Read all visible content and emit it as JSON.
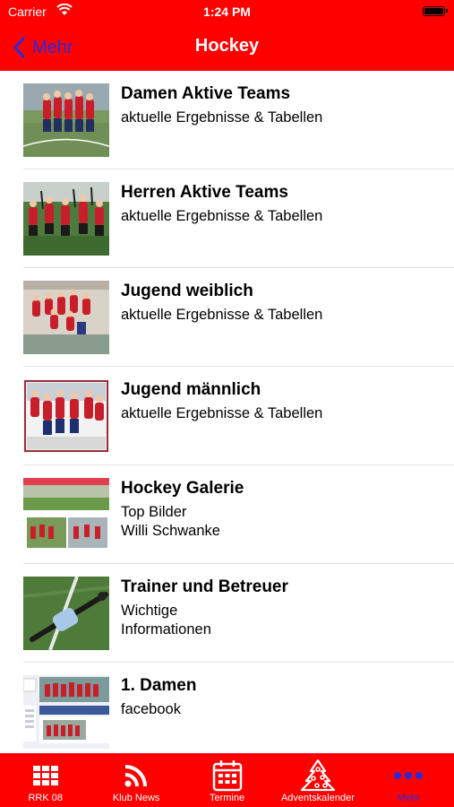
{
  "status": {
    "carrier": "Carrier",
    "time": "1:24 PM"
  },
  "nav": {
    "back_label": "Mehr",
    "title": "Hockey"
  },
  "items": [
    {
      "title": "Damen Aktive Teams",
      "subtitle": "aktuelle Ergebnisse & Tabellen",
      "thumb": "team-photo"
    },
    {
      "title": "Herren Aktive Teams",
      "subtitle": "aktuelle Ergebnisse & Tabellen",
      "thumb": "team-photo"
    },
    {
      "title": "Jugend weiblich",
      "subtitle": "aktuelle Ergebnisse & Tabellen",
      "thumb": "team-photo"
    },
    {
      "title": "Jugend männlich",
      "subtitle": "aktuelle Ergebnisse & Tabellen",
      "thumb": "team-photo"
    },
    {
      "title": "Hockey Galerie",
      "subtitle": "Top Bilder\nWilli Schwanke",
      "thumb": "gallery-photo"
    },
    {
      "title": "Trainer und Betreuer",
      "subtitle": "Wichtige\nInformationen",
      "thumb": "hockey-stick-photo"
    },
    {
      "title": "1. Damen",
      "subtitle": "facebook",
      "thumb": "facebook-page-photo"
    }
  ],
  "tabs": [
    {
      "label": "RRK 08",
      "icon": "grid-icon",
      "active": false
    },
    {
      "label": "Klub News",
      "icon": "rss-icon",
      "active": false
    },
    {
      "label": "Termine",
      "icon": "calendar-icon",
      "active": false
    },
    {
      "label": "Adventskalender",
      "icon": "christmas-tree-icon",
      "active": false
    },
    {
      "label": "Mehr",
      "icon": "more-icon",
      "active": true
    }
  ],
  "colors": {
    "brand_red": "#ff0000",
    "active_tab": "#2a2adc",
    "text": "#000000"
  }
}
